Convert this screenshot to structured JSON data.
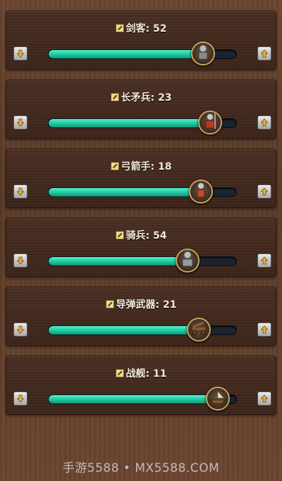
{
  "units": [
    {
      "label": "剑客: 52",
      "level": 0.82,
      "icon": "swordsman-icon"
    },
    {
      "label": "长矛兵: 23",
      "level": 0.86,
      "icon": "spearman-icon"
    },
    {
      "label": "弓箭手: 18",
      "level": 0.81,
      "icon": "archer-icon"
    },
    {
      "label": "骑兵: 54",
      "level": 0.74,
      "icon": "cavalry-icon"
    },
    {
      "label": "导弹武器: 21",
      "level": 0.8,
      "icon": "siege-weapon-icon"
    },
    {
      "label": "战舰: 11",
      "level": 0.9,
      "icon": "warship-icon"
    }
  ],
  "colors": {
    "fill": "#1fc69e",
    "track": "#1b2430",
    "panel": "#3c241a",
    "knob_ring": "#c9a463"
  },
  "watermark": "手游5588 • MX5588.COM"
}
